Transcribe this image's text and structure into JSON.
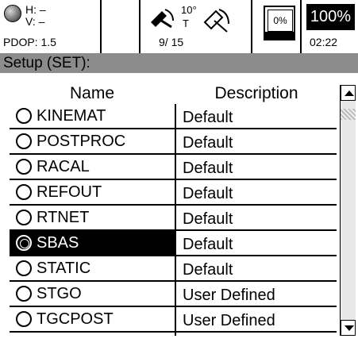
{
  "status": {
    "h_label": "H: –",
    "v_label": "V: –",
    "pdop": "PDOP: 1.5",
    "elevation_mask": "10°",
    "tracking_mode": "T",
    "satellites": "9/ 15",
    "memory": "0%",
    "battery": "100%",
    "time": "02:22"
  },
  "title": "Setup (SET):",
  "table": {
    "headers": [
      "Name",
      "Description"
    ],
    "rows": [
      {
        "name": "KINEMAT",
        "description": "Default"
      },
      {
        "name": "POSTPROC",
        "description": "Default"
      },
      {
        "name": "RACAL",
        "description": "Default"
      },
      {
        "name": "REFOUT",
        "description": "Default"
      },
      {
        "name": "RTNET",
        "description": "Default"
      },
      {
        "name": "SBAS",
        "description": "Default"
      },
      {
        "name": "STATIC",
        "description": "Default"
      },
      {
        "name": "STGO",
        "description": "User Defined"
      },
      {
        "name": "TGCPOST",
        "description": "User Defined"
      }
    ],
    "selected": "SBAS"
  },
  "icons": {
    "position_quality": "globe-icon",
    "satellite_tracking": "satellite-dish-icon",
    "satellite_lost": "satellite-outline-icon",
    "memory": "floppy-disk-icon",
    "scroll_up": "up-arrow-icon",
    "scroll_down": "down-arrow-icon"
  }
}
